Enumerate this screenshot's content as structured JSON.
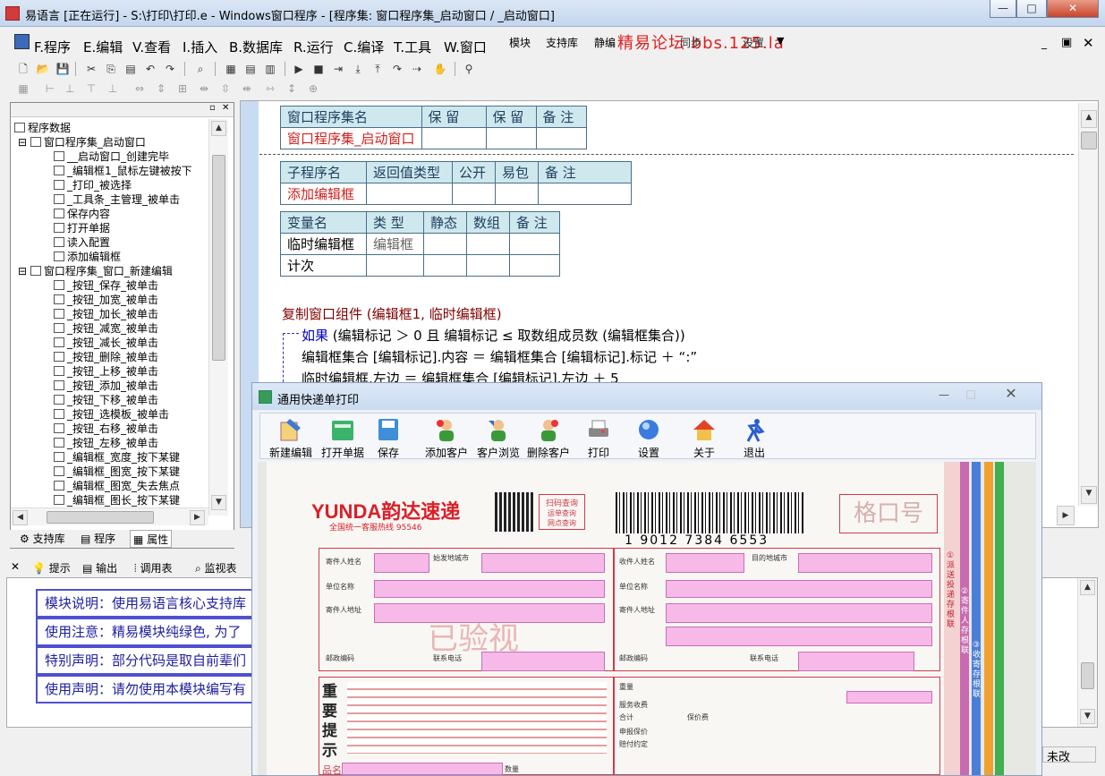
{
  "window": {
    "title": "易语言 [正在运行] - S:\\打印\\打印.e - Windows窗口程序 - [程序集: 窗口程序集_启动窗口 / _启动窗口]",
    "minimize": "—",
    "maximize": "□",
    "close": "✕"
  },
  "menu": {
    "items": [
      "F.程序",
      "E.编辑",
      "V.查看",
      "I.插入",
      "B.数据库",
      "R.运行",
      "C.编译",
      "T.工具",
      "W.窗口"
    ],
    "extra": [
      "模块",
      "支持库",
      "静编"
    ],
    "forum": "精易论坛 bbs.125.la",
    "extra2": [
      "同步",
      "设置"
    ]
  },
  "tree": {
    "root": "程序数据",
    "groups": [
      {
        "name": "窗口程序集_启动窗口",
        "items": [
          "__启动窗口_创建完毕",
          "_编辑框1_鼠标左键被按下",
          "_打印_被选择",
          "_工具条_主管理_被单击",
          "保存内容",
          "打开单据",
          "读入配置",
          "添加编辑框"
        ]
      },
      {
        "name": "窗口程序集_窗口_新建编辑",
        "items": [
          "_按钮_保存_被单击",
          "_按钮_加宽_被单击",
          "_按钮_加长_被单击",
          "_按钮_减宽_被单击",
          "_按钮_减长_被单击",
          "_按钮_删除_被单击",
          "_按钮_上移_被单击",
          "_按钮_添加_被单击",
          "_按钮_下移_被单击",
          "_按钮_选模板_被单击",
          "_按钮_右移_被单击",
          "_按钮_左移_被单击",
          "_编辑框_宽度_按下某键",
          "_编辑框_图宽_按下某键",
          "_编辑框_图宽_失去焦点",
          "_编辑框_图长_按下某键"
        ]
      }
    ]
  },
  "lefttabs": [
    "支持库",
    "程序",
    "属性"
  ],
  "table1": {
    "headers": [
      "窗口程序集名",
      "保 留",
      "保 留",
      "备 注"
    ],
    "row": [
      "窗口程序集_启动窗口",
      "",
      "",
      ""
    ]
  },
  "table2": {
    "headers": [
      "子程序名",
      "返回值类型",
      "公开",
      "易包",
      "备 注"
    ],
    "row": [
      "添加编辑框",
      "",
      "",
      "",
      ""
    ]
  },
  "table3": {
    "headers": [
      "变量名",
      "类 型",
      "静态",
      "数组",
      "备 注"
    ],
    "rows": [
      [
        "临时编辑框",
        "编辑框",
        "",
        "",
        ""
      ],
      [
        "计次",
        "",
        "",
        "",
        ""
      ]
    ]
  },
  "code": {
    "line1": "复制窗口组件 (编辑框1, 临时编辑框)",
    "line2_kw": "如果",
    "line2": " (编辑标记 ＞ 0 且 编辑标记 ≤ 取数组成员数 (编辑框集合))",
    "line3": "编辑框集合 [编辑标记].内容 ＝ 编辑框集合 [编辑标记].标记 ＋ “:”",
    "line4": "临时编辑框.左边 ＝ 编辑框集合 [编辑标记].左边 ＋ 5"
  },
  "outtabs": [
    "提示",
    "输出",
    "调用表",
    "监视表"
  ],
  "output": [
    "模块说明：使用易语言核心支持库",
    "使用注意：精易模块纯绿色, 为了",
    "特别声明：部分代码是取自前辈们",
    "使用声明：请勿使用本模块编写有"
  ],
  "status": "未改",
  "dialog": {
    "title": "通用快递单打印",
    "buttons": [
      "新建编辑",
      "打开单据",
      "保存",
      "添加客户",
      "客户浏览",
      "删除客户",
      "打印",
      "设置",
      "关于",
      "退出"
    ]
  },
  "waybill": {
    "brand": "YUNDA韵达速递",
    "hotline": "全国统一客服热线 95546",
    "scan": [
      "扫码查询",
      "运单查询",
      "网点查询"
    ],
    "barcode": "1 9012 7384 6553",
    "box": "格口号",
    "stamp": "已验视",
    "labels": {
      "sender": "寄件人姓名",
      "origin": "始发地城市",
      "company": "单位名称",
      "address": "寄件人地址",
      "postcode": "邮政编码",
      "phone": "联系电话",
      "receiver": "收件人姓名",
      "dest": "目的地城市",
      "weight": "重量",
      "fee": "服务收费",
      "total": "合计",
      "insure": "保价费",
      "guarantee": "申报保价",
      "agreement": "赔付约定"
    },
    "notice": "重要提示",
    "item": "品名",
    "count": "数量",
    "side": [
      "①派送投递存根联",
      "②寄件人存根联",
      "③收寄存根联"
    ]
  },
  "colors": {
    "accent": "#d02020",
    "table_border": "#4a6f89",
    "header_bg": "#cfe8ee",
    "pink": "#f6b9e8"
  }
}
